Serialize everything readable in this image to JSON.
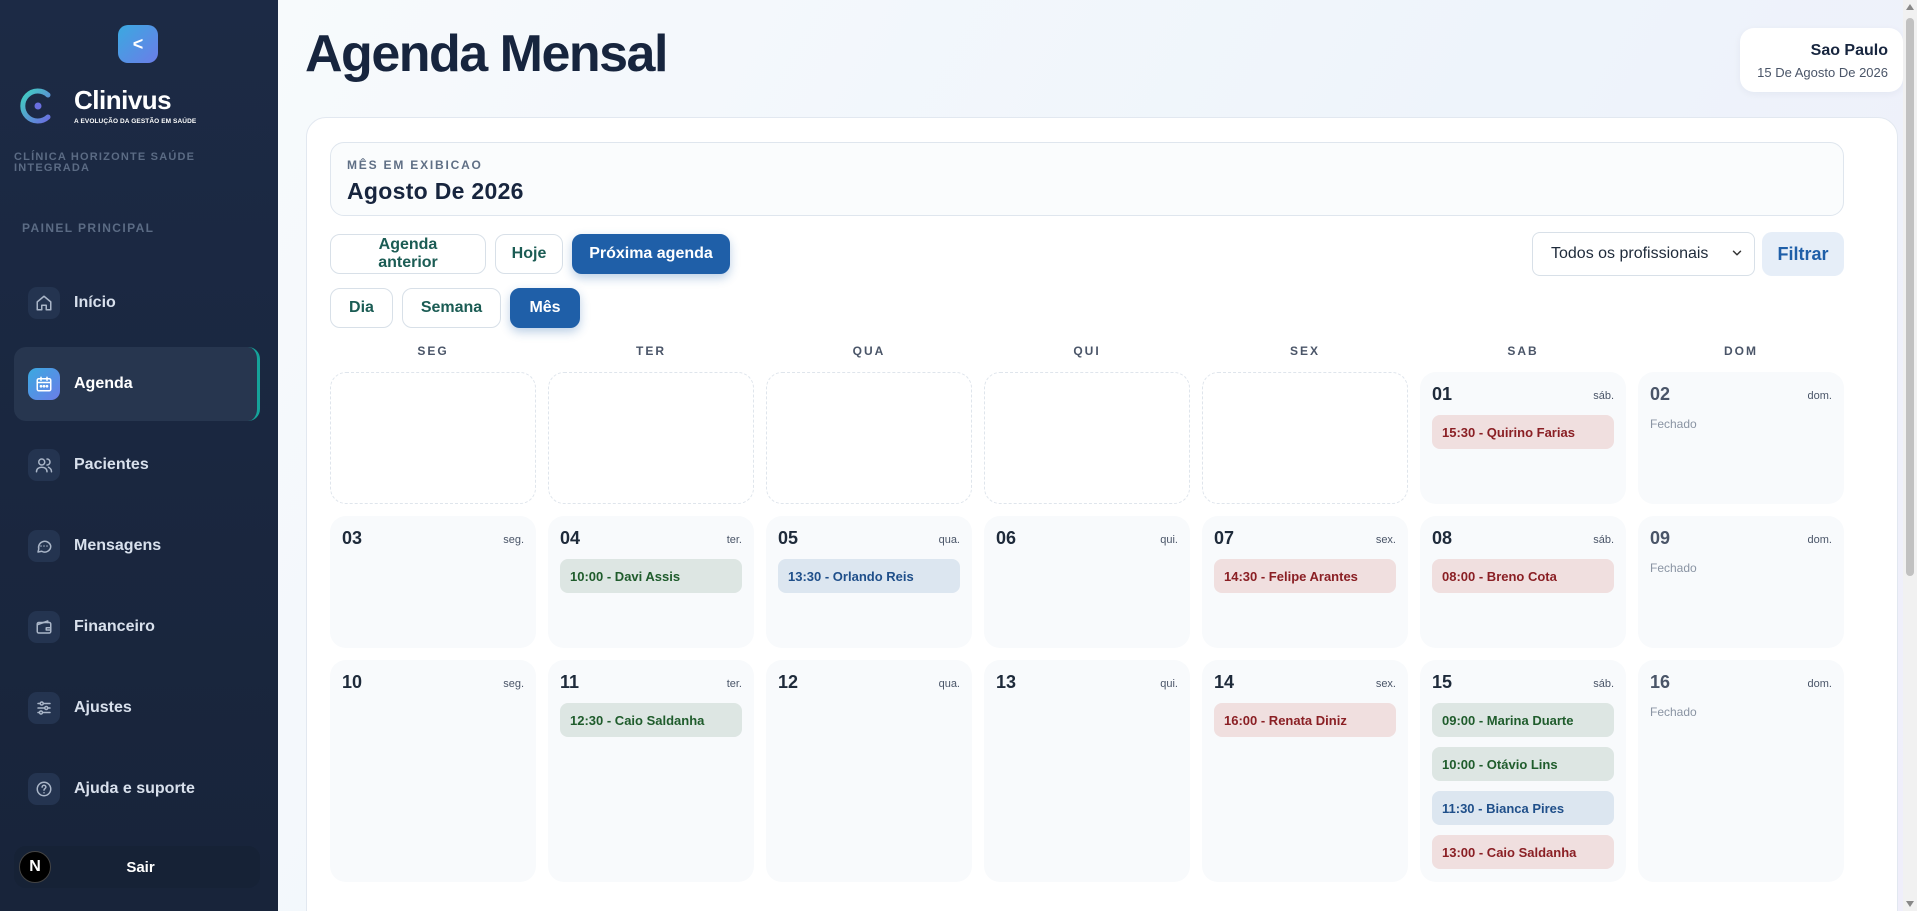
{
  "app": {
    "collapse_label": "<",
    "logo_name": "Clinivus",
    "logo_tagline": "A EVOLUÇÃO DA GESTÃO EM SAÚDE",
    "clinic_name": "CLÍNICA HORIZONTE SAÚDE INTEGRADA",
    "panel_label": "PAINEL PRINCIPAL"
  },
  "colors": {
    "accent": "#1f5fa8",
    "sidebar": "#1c2a45",
    "active_border": "#15a39a"
  },
  "sidebar": {
    "items": [
      {
        "label": "Início",
        "icon": "home-icon",
        "active": false
      },
      {
        "label": "Agenda",
        "icon": "calendar-icon",
        "active": true
      },
      {
        "label": "Pacientes",
        "icon": "users-icon",
        "active": false
      },
      {
        "label": "Mensagens",
        "icon": "message-icon",
        "active": false
      },
      {
        "label": "Financeiro",
        "icon": "wallet-icon",
        "active": false
      },
      {
        "label": "Ajustes",
        "icon": "sliders-icon",
        "active": false
      },
      {
        "label": "Ajuda e suporte",
        "icon": "help-icon",
        "active": false
      }
    ],
    "logout_label": "Sair",
    "logout_badge": "N"
  },
  "header": {
    "title": "Agenda Mensal",
    "city": "Sao Paulo",
    "date": "15 De Agosto De 2026"
  },
  "month": {
    "label": "MÊS EM EXIBICAO",
    "value": "Agosto De 2026"
  },
  "toolbar": {
    "prev_label": "Agenda anterior",
    "today_label": "Hoje",
    "next_label": "Próxima agenda",
    "professional_select": "Todos os profissionais",
    "filter_label": "Filtrar"
  },
  "views": {
    "day": "Dia",
    "week": "Semana",
    "month": "Mês",
    "selected": "month"
  },
  "calendar": {
    "weekdays": [
      "SEG",
      "TER",
      "QUA",
      "QUI",
      "SEX",
      "SAB",
      "DOM"
    ],
    "closed_label": "Fechado",
    "weeks": [
      [
        null,
        null,
        null,
        null,
        null,
        {
          "day": "01",
          "abbr": "sáb.",
          "appointments": [
            {
              "text": "15:30 - Quirino Farias",
              "status": "red"
            }
          ]
        },
        {
          "day": "02",
          "abbr": "dom.",
          "closed": true,
          "appointments": []
        }
      ],
      [
        {
          "day": "03",
          "abbr": "seg.",
          "appointments": []
        },
        {
          "day": "04",
          "abbr": "ter.",
          "appointments": [
            {
              "text": "10:00 - Davi Assis",
              "status": "green"
            }
          ]
        },
        {
          "day": "05",
          "abbr": "qua.",
          "appointments": [
            {
              "text": "13:30 - Orlando Reis",
              "status": "blue"
            }
          ]
        },
        {
          "day": "06",
          "abbr": "qui.",
          "appointments": []
        },
        {
          "day": "07",
          "abbr": "sex.",
          "appointments": [
            {
              "text": "14:30 - Felipe Arantes",
              "status": "red"
            }
          ]
        },
        {
          "day": "08",
          "abbr": "sáb.",
          "appointments": [
            {
              "text": "08:00 - Breno Cota",
              "status": "red"
            }
          ]
        },
        {
          "day": "09",
          "abbr": "dom.",
          "closed": true,
          "appointments": []
        }
      ],
      [
        {
          "day": "10",
          "abbr": "seg.",
          "appointments": []
        },
        {
          "day": "11",
          "abbr": "ter.",
          "appointments": [
            {
              "text": "12:30 - Caio Saldanha",
              "status": "green"
            }
          ]
        },
        {
          "day": "12",
          "abbr": "qua.",
          "appointments": []
        },
        {
          "day": "13",
          "abbr": "qui.",
          "appointments": []
        },
        {
          "day": "14",
          "abbr": "sex.",
          "appointments": [
            {
              "text": "16:00 - Renata Diniz",
              "status": "red"
            }
          ]
        },
        {
          "day": "15",
          "abbr": "sáb.",
          "appointments": [
            {
              "text": "09:00 - Marina Duarte",
              "status": "green"
            },
            {
              "text": "10:00 - Otávio Lins",
              "status": "green"
            },
            {
              "text": "11:30 - Bianca Pires",
              "status": "blue"
            },
            {
              "text": "13:00 - Caio Saldanha",
              "status": "red"
            }
          ]
        },
        {
          "day": "16",
          "abbr": "dom.",
          "closed": true,
          "appointments": []
        }
      ]
    ]
  }
}
